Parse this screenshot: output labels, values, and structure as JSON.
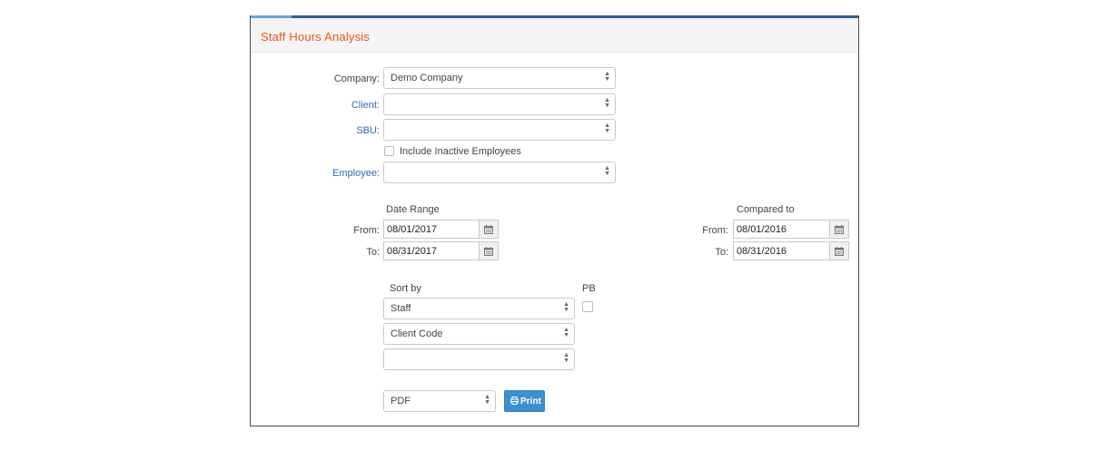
{
  "header": {
    "title": "Staff Hours Analysis"
  },
  "filters": {
    "company": {
      "label": "Company:",
      "value": "Demo Company"
    },
    "client": {
      "label": "Client:",
      "value": ""
    },
    "sbu": {
      "label": "SBU:",
      "value": ""
    },
    "include_inactive": {
      "label": "Include Inactive Employees",
      "checked": false
    },
    "employee": {
      "label": "Employee:",
      "value": ""
    }
  },
  "date_range": {
    "heading": "Date Range",
    "from_label": "From:",
    "from_value": "08/01/2017",
    "to_label": "To:",
    "to_value": "08/31/2017"
  },
  "compared_to": {
    "heading": "Compared to",
    "from_label": "From:",
    "from_value": "08/01/2016",
    "to_label": "To:",
    "to_value": "08/31/2016"
  },
  "sort": {
    "heading": "Sort by",
    "pb_label": "PB",
    "sort1": "Staff",
    "sort2": "Client Code",
    "sort3": ""
  },
  "output": {
    "format": "PDF",
    "print_label": "Print"
  },
  "icons": {
    "select_arrows": "updown-arrows-icon",
    "calendar": "calendar-icon",
    "print": "print-icon"
  },
  "colors": {
    "title": "#e8571e",
    "link_label": "#2e6ab0",
    "primary_button": "#3f8fd0",
    "top_bar": "#365f8c"
  }
}
